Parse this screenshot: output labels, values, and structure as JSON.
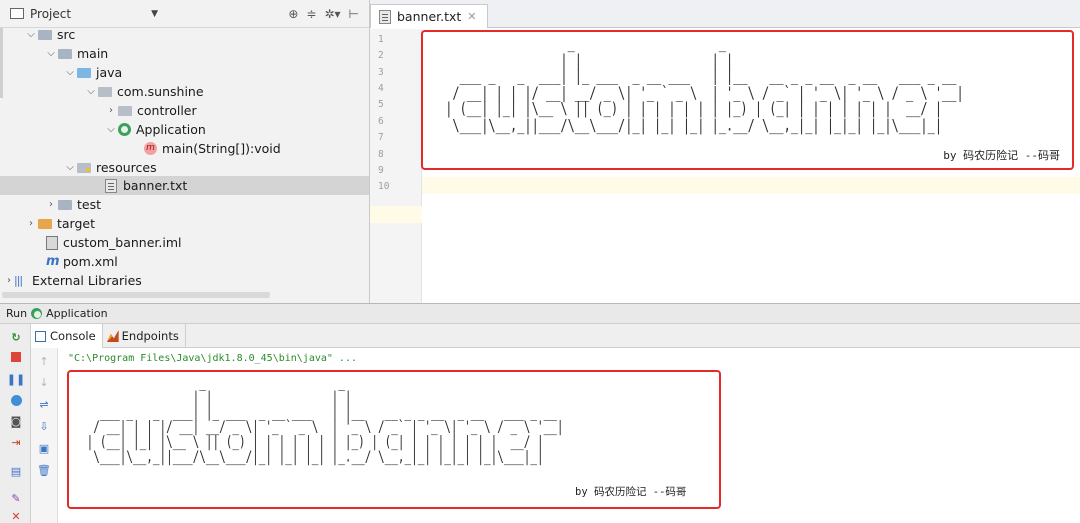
{
  "project": {
    "title": "Project",
    "tree": {
      "src": "src",
      "main": "main",
      "java": "java",
      "package": "com.sunshine",
      "controller": "controller",
      "application": "Application",
      "method": "main(String[]):void",
      "resources": "resources",
      "banner": "banner.txt",
      "test": "test",
      "target": "target",
      "iml": "custom_banner.iml",
      "pom": "pom.xml",
      "libraries": "External Libraries"
    }
  },
  "editor": {
    "tab_label": "banner.txt",
    "line_numbers": [
      "1",
      "2",
      "3",
      "4",
      "5",
      "6",
      "7",
      "8",
      "9",
      "10"
    ],
    "banner_ascii": "                  _                    _\n                 | |                  | |\n   ___ _   _  ___| |_ ___  _ __ ___   | |__   __ _ _ __  _ __   ___ _ __\n  / __| | | |/ __| __/ _ \\| '_ ` _ \\  | '_ \\ / _` | '_ \\| '_ \\ / _ \\ '__|\n | (__| |_| |\\__ \\ || (_) | | | | | | | |_) | (_| | | | | | | |  __/ |\n  \\___|\\__,_||___/\\__\\___/|_| |_| |_| |_.__/ \\__,_|_| |_|_| |_|\\___|_|",
    "byline": "by 码农历险记 --码哥"
  },
  "run": {
    "label": "Run",
    "app": "Application",
    "tabs": {
      "console": "Console",
      "endpoints": "Endpoints"
    },
    "command": "\"C:\\Program Files\\Java\\jdk1.8.0_45\\bin\\java\" ...",
    "banner_ascii": "                  _                    _\n                 | |                  | |\n   ___ _   _  ___| |_ ___  _ __ ___   | |__   __ _ _ __  _ __   ___ _ __\n  / __| | | |/ __| __/ _ \\| '_ ` _ \\  | '_ \\ / _` | '_ \\| '_ \\ / _ \\ '__|\n | (__| |_| |\\__ \\ || (_) | | | | | | | |_) | (_| | | | | | | |  __/ |\n  \\___|\\__,_||___/\\__\\___/|_| |_| |_| |_.__/ \\__,_|_| |_|_| |_|\\___|_|",
    "byline": "by 码农历险记 --码哥"
  },
  "colors": {
    "highlight_box": "#e52a2a",
    "console_command": "#2c8a2c",
    "selected_row": "#d4d4d4"
  }
}
